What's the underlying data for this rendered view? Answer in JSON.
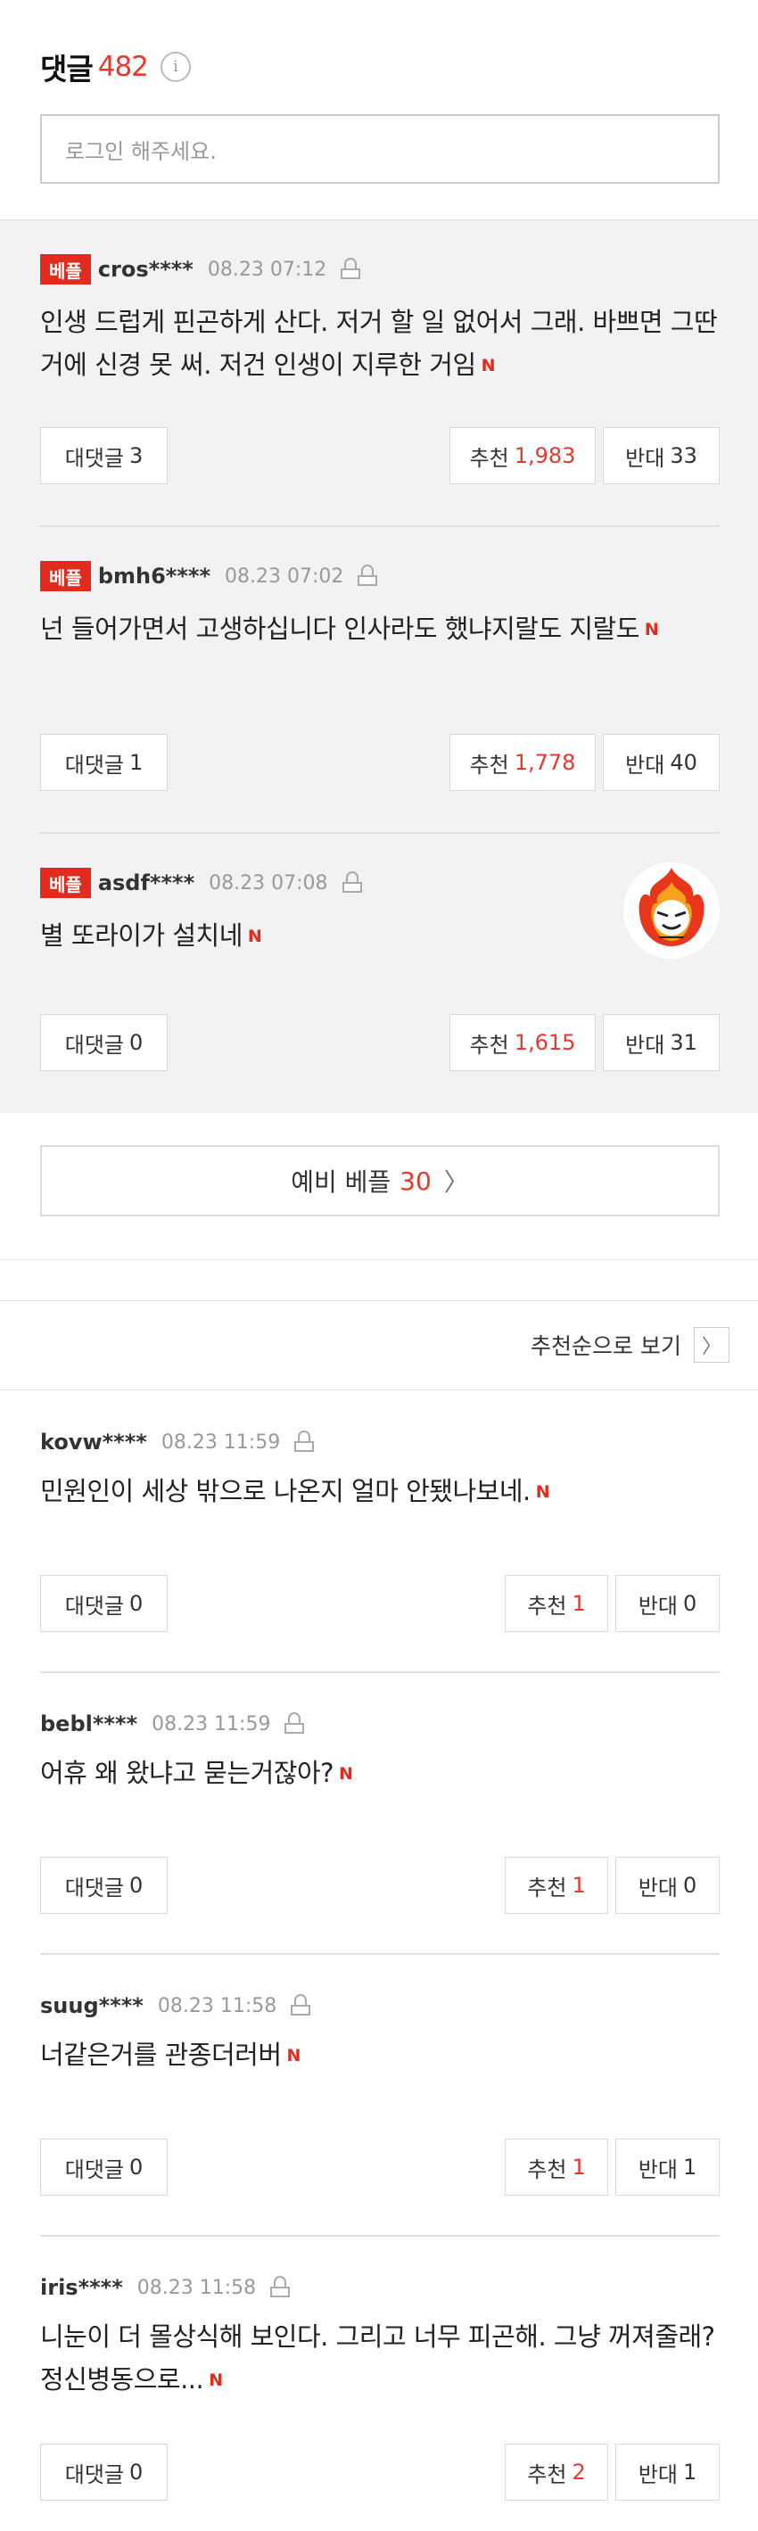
{
  "header": {
    "title": "댓글",
    "count": "482",
    "info_icon": "i"
  },
  "login_prompt": "로그인 해주세요.",
  "best_badge": "베플",
  "best_comments": [
    {
      "user": "cros****",
      "date": "08.23 07:12",
      "text": "인생 드럽게 핀곤하게 산다. 저거 할 일 없어서 그래. 바쁘면 그딴거에 신경 못 써. 저건 인생이 지루한 거임",
      "reply_label": "대댓글",
      "replies": "3",
      "like_label": "추천",
      "likes": "1,983",
      "dislike_label": "반대",
      "dislikes": "33"
    },
    {
      "user": "bmh6****",
      "date": "08.23 07:02",
      "text": "넌 들어가면서 고생하십니다 인사라도 했냐지랄도 지랄도",
      "reply_label": "대댓글",
      "replies": "1",
      "like_label": "추천",
      "likes": "1,778",
      "dislike_label": "반대",
      "dislikes": "40"
    },
    {
      "user": "asdf****",
      "date": "08.23 07:08",
      "text": "별 또라이가 설치네",
      "reply_label": "대댓글",
      "replies": "0",
      "like_label": "추천",
      "likes": "1,615",
      "dislike_label": "반대",
      "dislikes": "31",
      "avatar": "flame-skull-avatar"
    }
  ],
  "more_best": {
    "label": "예비 베플",
    "count": "30",
    "chevron": "〉"
  },
  "sort": {
    "label": "추천순으로 보기",
    "chevron": "〉"
  },
  "comments": [
    {
      "user": "kovw****",
      "date": "08.23 11:59",
      "text": "민원인이 세상 밖으로 나온지 얼마 안됐나보네.",
      "reply_label": "대댓글",
      "replies": "0",
      "like_label": "추천",
      "likes": "1",
      "dislike_label": "반대",
      "dislikes": "0"
    },
    {
      "user": "bebl****",
      "date": "08.23 11:59",
      "text": "어휴 왜 왔냐고 묻는거잖아?",
      "reply_label": "대댓글",
      "replies": "0",
      "like_label": "추천",
      "likes": "1",
      "dislike_label": "반대",
      "dislikes": "0"
    },
    {
      "user": "suug****",
      "date": "08.23 11:58",
      "text": "너같은거를 관종더러버",
      "reply_label": "대댓글",
      "replies": "0",
      "like_label": "추천",
      "likes": "1",
      "dislike_label": "반대",
      "dislikes": "1"
    },
    {
      "user": "iris****",
      "date": "08.23 11:58",
      "text": "니눈이 더 몰상식해 보인다. 그리고 너무 피곤해. 그냥 꺼져줄래? 정신병동으로...",
      "reply_label": "대댓글",
      "replies": "0",
      "like_label": "추천",
      "likes": "2",
      "dislike_label": "반대",
      "dislikes": "1"
    }
  ],
  "new_icon": "N",
  "colors": {
    "accent": "#e22b1c",
    "best_bg": "#f2f2f2"
  }
}
